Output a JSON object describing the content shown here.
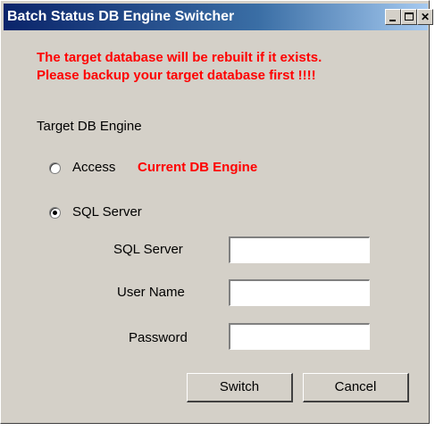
{
  "window": {
    "title": "Batch Status DB Engine Switcher"
  },
  "warning": {
    "line1": "The target database will be rebuilt if it exists.",
    "line2": "Please backup your target database first !!!!"
  },
  "engine": {
    "group_label": "Target DB Engine",
    "options": [
      {
        "label": "Access",
        "selected": false
      },
      {
        "label": "SQL Server",
        "selected": true
      }
    ],
    "current_label": "Current DB Engine"
  },
  "form": {
    "server_label": "SQL Server",
    "server_value": "",
    "user_label": "User Name",
    "user_value": "",
    "password_label": "Password",
    "password_value": ""
  },
  "buttons": {
    "switch_label": "Switch",
    "cancel_label": "Cancel"
  },
  "colors": {
    "warning": "#ff0000",
    "titlebar": "#0a246a",
    "window_bg": "#d4d0c8"
  }
}
